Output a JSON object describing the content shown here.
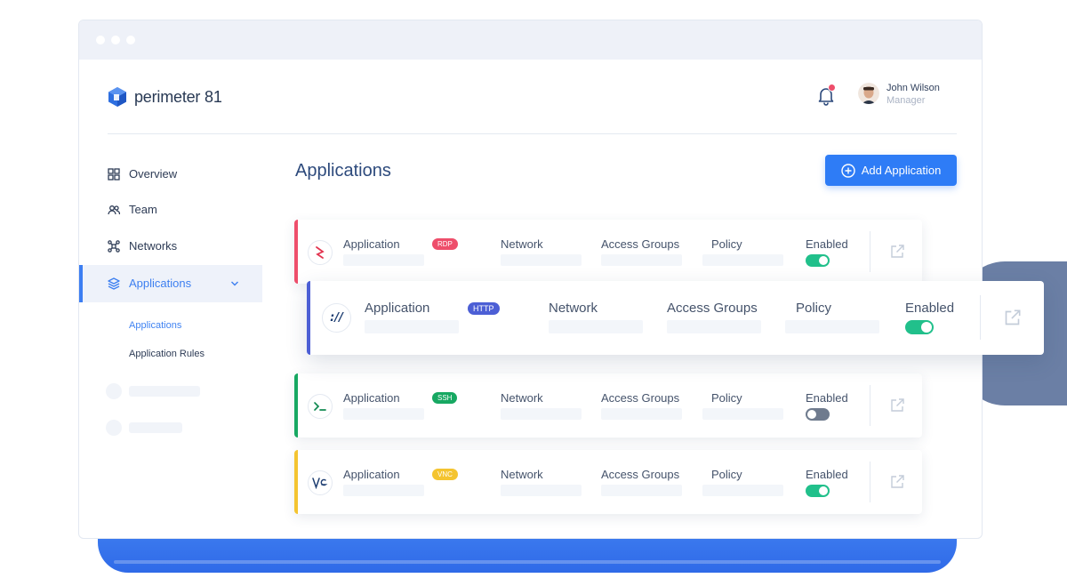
{
  "brand": {
    "name": "perimeter 81"
  },
  "header": {
    "user_name": "John Wilson",
    "user_role": "Manager",
    "notification_color": "#ee4e6b"
  },
  "sidebar": {
    "items": [
      {
        "label": "Overview",
        "icon": "grid-icon"
      },
      {
        "label": "Team",
        "icon": "users-icon"
      },
      {
        "label": "Networks",
        "icon": "network-icon"
      },
      {
        "label": "Applications",
        "icon": "layers-icon",
        "active": true,
        "expanded": true
      }
    ],
    "sub_items": [
      {
        "label": "Applications",
        "active": true
      },
      {
        "label": "Application Rules"
      }
    ]
  },
  "main": {
    "title": "Applications",
    "add_button_label": "Add Application",
    "columns": {
      "application": "Application",
      "network": "Network",
      "access_groups": "Access Groups",
      "policy": "Policy",
      "enabled": "Enabled"
    },
    "apps": [
      {
        "protocol": "RDP",
        "color": "#ee4e6b",
        "icon": "rdp-icon",
        "enabled": true
      },
      {
        "protocol": "HTTP",
        "color": "#4c5fd5",
        "icon": "http-icon",
        "enabled": true
      },
      {
        "protocol": "SSH",
        "color": "#17a862",
        "icon": "terminal-icon",
        "enabled": false
      },
      {
        "protocol": "VNC",
        "color": "#f4c430",
        "icon": "vnc-icon",
        "enabled": true
      }
    ]
  }
}
